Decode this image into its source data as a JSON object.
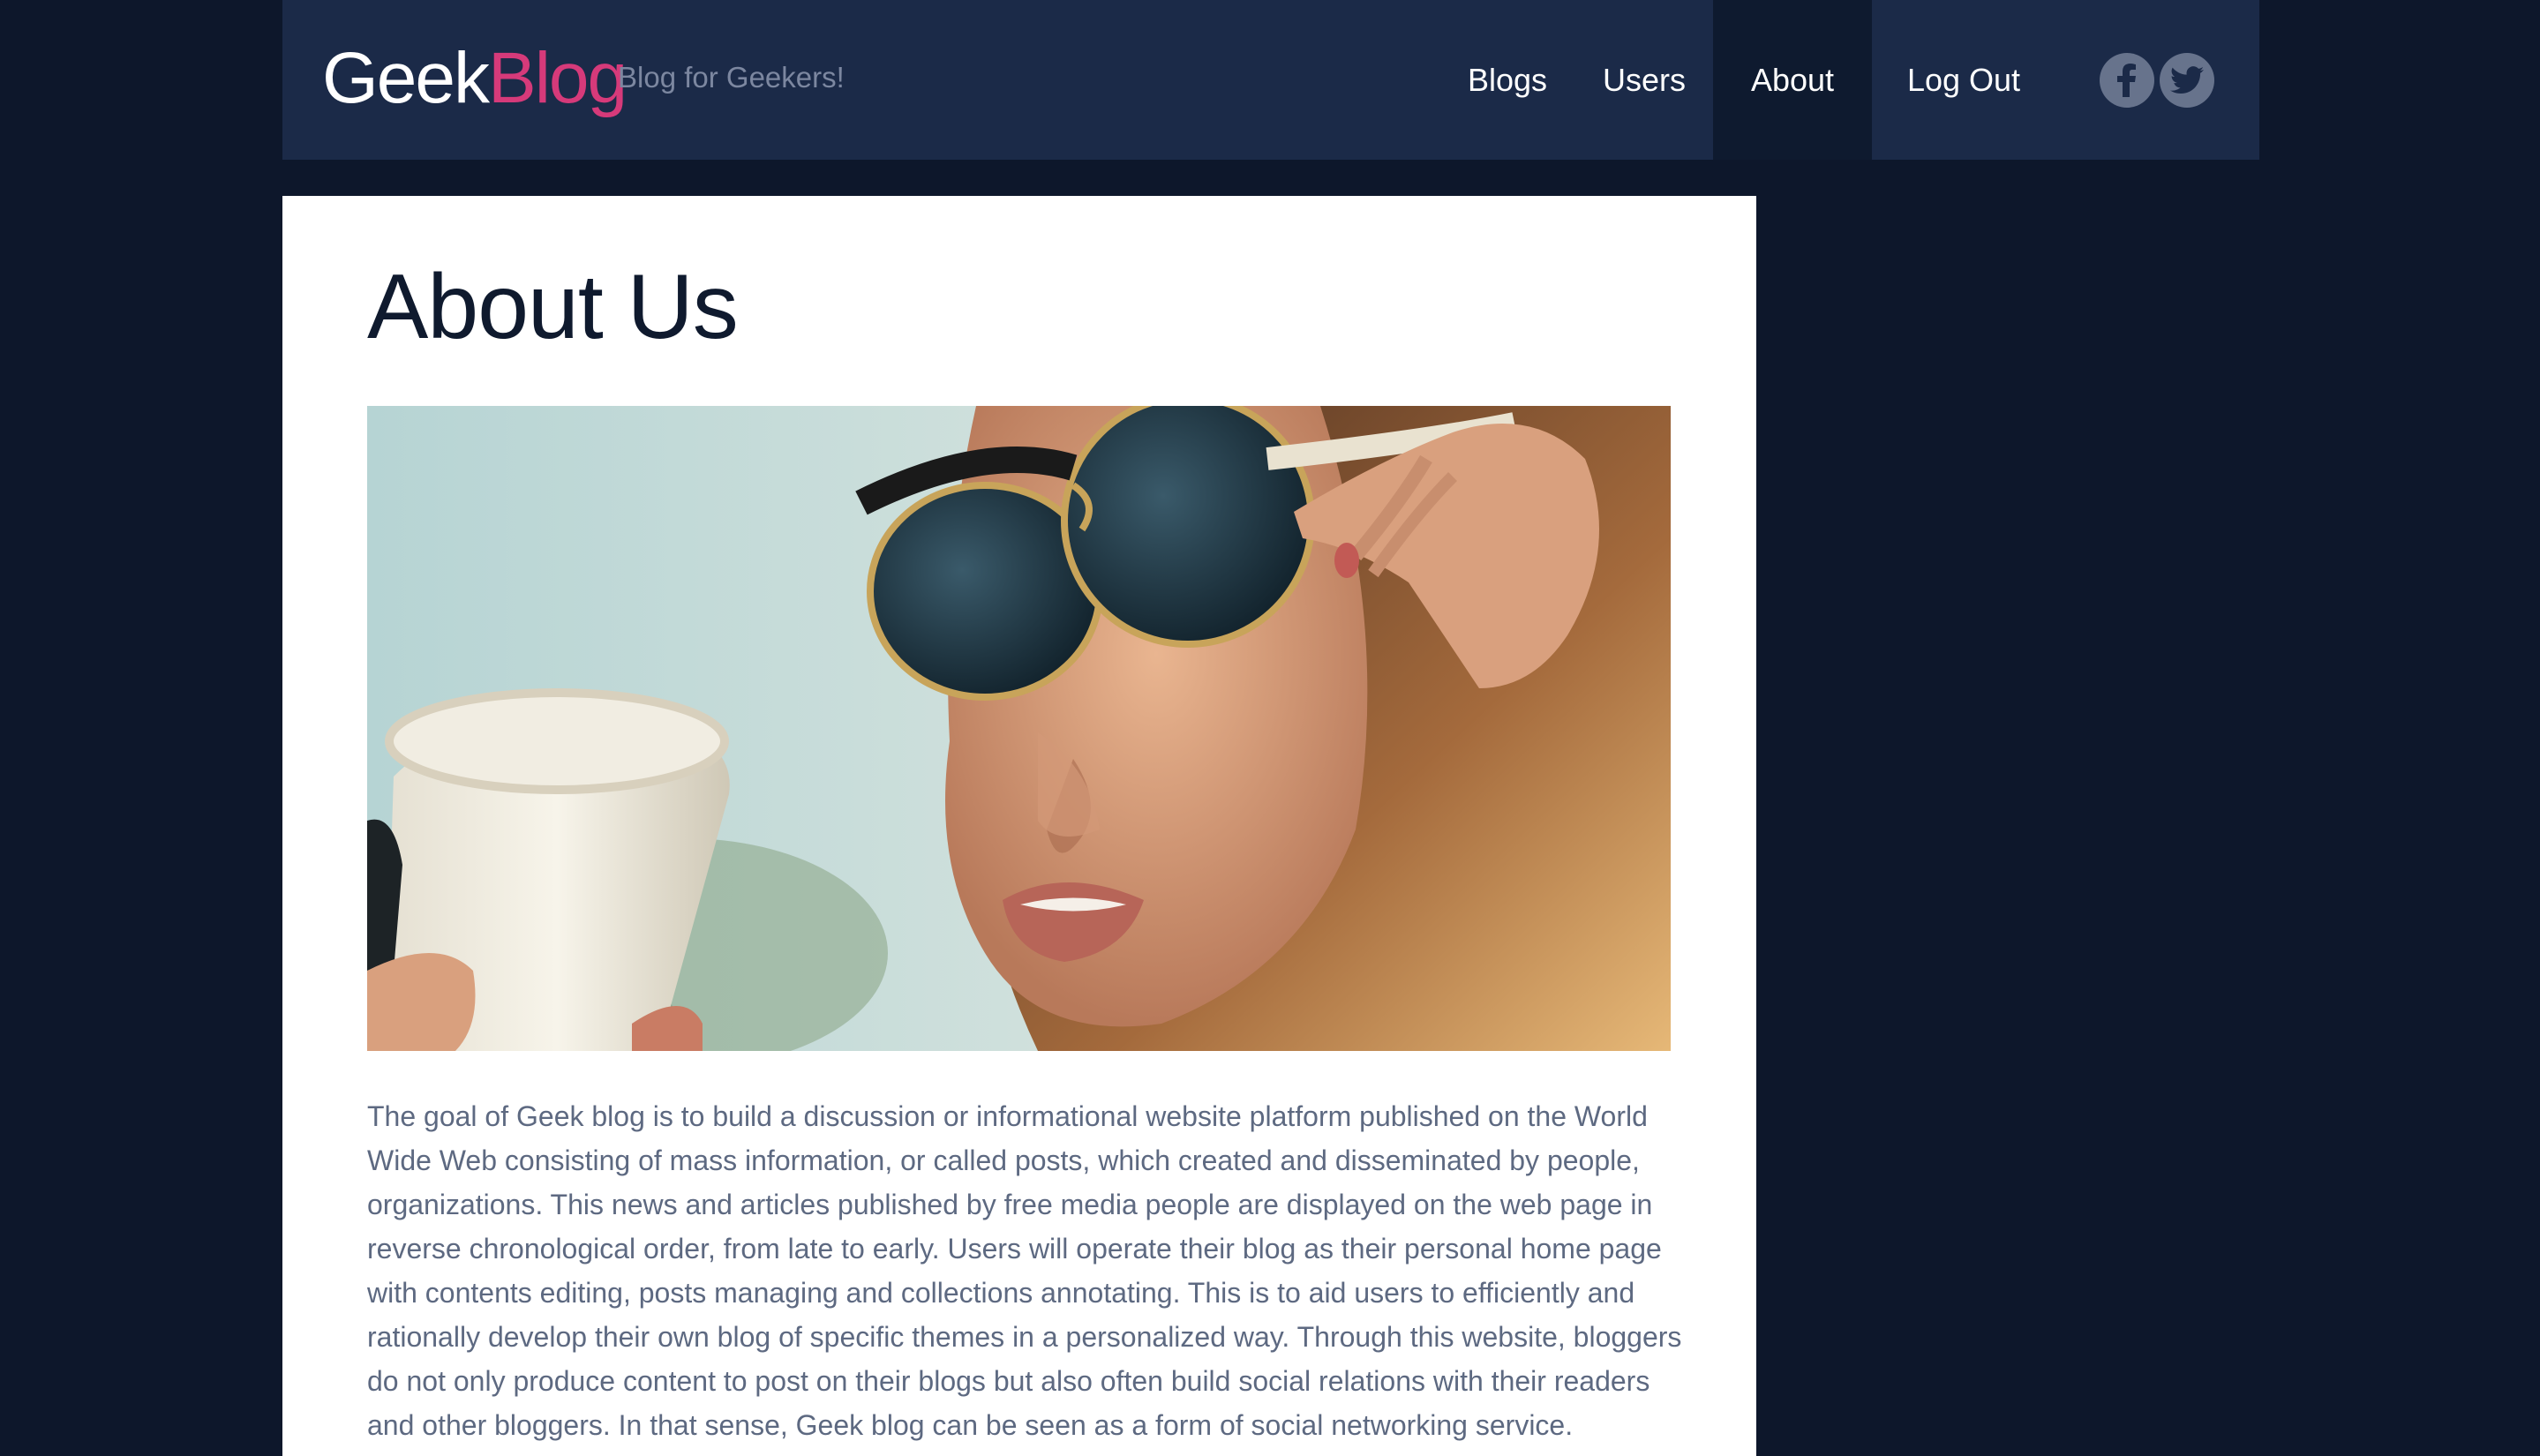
{
  "brand": {
    "name_part1": "Geek",
    "name_part2": "Blog",
    "tagline": "Blog for Geekers!",
    "accent_color": "#d63a7a"
  },
  "nav": {
    "items": [
      {
        "label": "Blogs"
      },
      {
        "label": "Users"
      },
      {
        "label": "About",
        "active": true
      },
      {
        "label": "Log Out"
      }
    ],
    "social": [
      {
        "icon": "facebook-icon"
      },
      {
        "icon": "twitter-icon"
      }
    ]
  },
  "page": {
    "title": "About Us",
    "hero_image": "woman-sunglasses-drinking-coffee-photo",
    "body": "The goal of Geek blog is to build a discussion or informational website platform published on the World Wide Web consisting of mass information, or called posts, which created and disseminated by people, organizations. This news and articles published by free media people are displayed on the web page in reverse chronological order, from late to early. Users will operate their blog as their personal home page with contents editing, posts managing and collections annotating. This is to aid users to efficiently and rationally develop their own blog of specific themes in a personalized way. Through this website, bloggers do not only produce content to post on their blogs but also often build social relations with their readers and other bloggers. In that sense, Geek blog can be seen as a form of social networking service."
  },
  "colors": {
    "page_background": "#0d172b",
    "header_background": "#1b2a48",
    "active_nav_background": "#0e1a2f",
    "content_background": "#ffffff",
    "body_text": "#5d6981"
  }
}
